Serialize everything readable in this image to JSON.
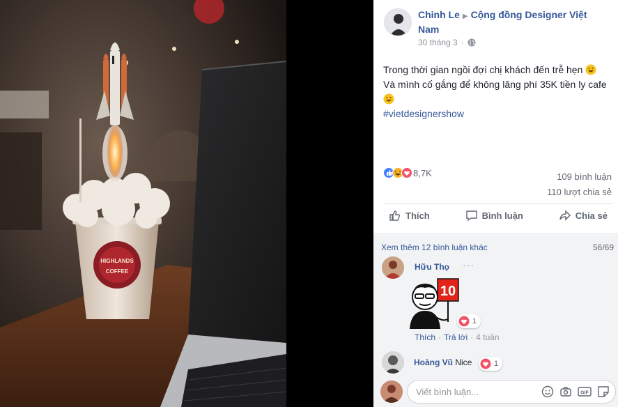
{
  "post": {
    "author": "Chinh Le",
    "group": "Cộng đồng Designer Việt Nam",
    "date": "30 tháng 3",
    "privacy_icon": "globe-icon",
    "text_line1": "Trong thời gian ngồi đợi chị khách đến trễ hẹn",
    "text_line2": "Và mình cố gắng để không lãng phí 35K tiền ly cafe",
    "hashtag": "#vietdesignershow"
  },
  "reactions": {
    "count": "8,7K",
    "types": [
      "like",
      "haha",
      "love"
    ],
    "comments": "109 bình luận",
    "shares": "110 lượt chia sẻ"
  },
  "actions": {
    "like": "Thích",
    "comment": "Bình luận",
    "share": "Chia sẻ"
  },
  "comments": {
    "view_more": "Xem thêm 12 bình luận khác",
    "counter": "56/69",
    "items": [
      {
        "name": "Hữu Thọ",
        "sticker_text": "10",
        "reaction_count": "1",
        "like": "Thích",
        "reply": "Trả lời",
        "time": "4 tuần"
      },
      {
        "name": "Hoàng Vũ",
        "text": "Nice",
        "reaction_count": "1"
      }
    ]
  },
  "composer": {
    "placeholder": "Viết bình luận..."
  },
  "colors": {
    "link": "#365899",
    "muted": "#90949c",
    "like_blue": "#4080ff",
    "love_red": "#f25268",
    "haha_yellow": "#f7b125"
  }
}
